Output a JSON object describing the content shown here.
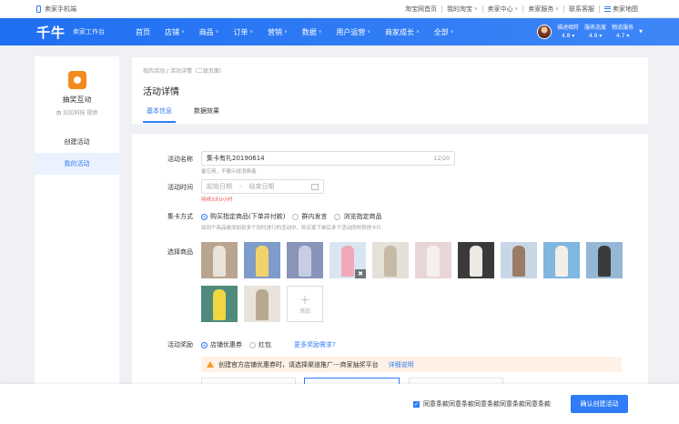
{
  "topbar": {
    "mobile_label": "卖家手机端",
    "links": [
      {
        "label": "淘宝网首页",
        "caret": false,
        "icon": ""
      },
      {
        "label": "我的淘宝",
        "caret": true,
        "icon": ""
      },
      {
        "label": "卖家中心",
        "caret": true,
        "icon": ""
      },
      {
        "label": "卖家服务",
        "caret": true,
        "icon": ""
      },
      {
        "label": "联系客服",
        "caret": false,
        "icon": ""
      },
      {
        "label": "卖家地图",
        "caret": false,
        "icon": "grid-icon"
      }
    ]
  },
  "nav": {
    "logo": "千牛",
    "logo_sub": "卖家工作台",
    "items": [
      {
        "label": "首页",
        "caret": false
      },
      {
        "label": "店铺",
        "caret": true
      },
      {
        "label": "商品",
        "caret": true
      },
      {
        "label": "订单",
        "caret": true
      },
      {
        "label": "营销",
        "caret": true
      },
      {
        "label": "数据",
        "caret": true
      },
      {
        "label": "用户运营",
        "caret": true
      },
      {
        "label": "商家成长",
        "caret": true
      },
      {
        "label": "全部",
        "caret": true
      }
    ],
    "scores": [
      {
        "label": "描述相符",
        "value": "4.8"
      },
      {
        "label": "服务态度",
        "value": "4.9"
      },
      {
        "label": "物流服务",
        "value": "4.7"
      }
    ]
  },
  "sidebar": {
    "app_name": "抽奖互动",
    "provider": "由 拉拉科技 提供",
    "items": [
      {
        "label": "创建活动",
        "active": false
      },
      {
        "label": "我的活动",
        "active": true
      }
    ]
  },
  "header": {
    "breadcrumb": "我的活动 / 活动详情（二级页面）",
    "title": "活动详情",
    "tabs": [
      {
        "label": "基本信息",
        "active": true
      },
      {
        "label": "数据效果",
        "active": false
      }
    ]
  },
  "form": {
    "name_label": "活动名称",
    "name_value": "集卡有礼20190614",
    "name_count": "12/20",
    "name_hint": "备忘用，不展示给消费者",
    "time_label": "活动时间",
    "time_start_placeholder": "起始日期",
    "time_separator": "-",
    "time_end_placeholder": "结束日期",
    "time_hint": "持续3天0小时",
    "mode_label": "集卡方式",
    "mode_options": [
      {
        "label": "购买指定商品(下单并付款)",
        "checked": true
      },
      {
        "label": "群内发言",
        "checked": false
      },
      {
        "label": "浏览指定商品",
        "checked": false
      }
    ],
    "mode_hint": "如同个商品被添加到多个同时进行的活动中，则买家下单后多个活动同时获得卡片",
    "goods_label": "选择商品",
    "add_label": "添加",
    "reward_label": "活动奖励",
    "reward_options": [
      {
        "label": "店铺优惠券",
        "checked": true
      },
      {
        "label": "红包",
        "checked": false
      }
    ],
    "more_reward_link": "更多奖励需求?",
    "notice_text": "创建官方店铺优惠券时，请选择渠道推广---商家抽奖平台",
    "notice_link": "详细说明"
  },
  "products": [
    {
      "bg": "#b9a58f",
      "fg": "#e9e2d8",
      "trash": false
    },
    {
      "bg": "#7e9cc9",
      "fg": "#f2d36b",
      "trash": false
    },
    {
      "bg": "#8a93b8",
      "fg": "#c8cde3",
      "trash": false
    },
    {
      "bg": "#d9e6f2",
      "fg": "#f0a8b8",
      "trash": true
    },
    {
      "bg": "#e6e1d8",
      "fg": "#c7bba7",
      "trash": false
    },
    {
      "bg": "#e8d6d9",
      "fg": "#f4f0f0",
      "trash": false
    },
    {
      "bg": "#3a3a3a",
      "fg": "#ece8e4",
      "trash": false
    },
    {
      "bg": "#c8d7e6",
      "fg": "#9a7b66",
      "trash": false
    },
    {
      "bg": "#7fb7e0",
      "fg": "#f3eee8",
      "trash": false
    },
    {
      "bg": "#95b7d6",
      "fg": "#3b3b3b",
      "trash": false
    },
    {
      "bg": "#4f8a7c",
      "fg": "#f0d640",
      "trash": false
    },
    {
      "bg": "#e9e3dc",
      "fg": "#b8a88e",
      "trash": false
    }
  ],
  "footer": {
    "agree_text": "同意条款同意条款同意条款同意条款同意条款",
    "submit_label": "确认创建活动"
  },
  "colors": {
    "accent": "#2f7cf6",
    "nav_blue": "#1f6ff2",
    "warning": "#f59a23",
    "notice_bg": "#fff1e6"
  }
}
